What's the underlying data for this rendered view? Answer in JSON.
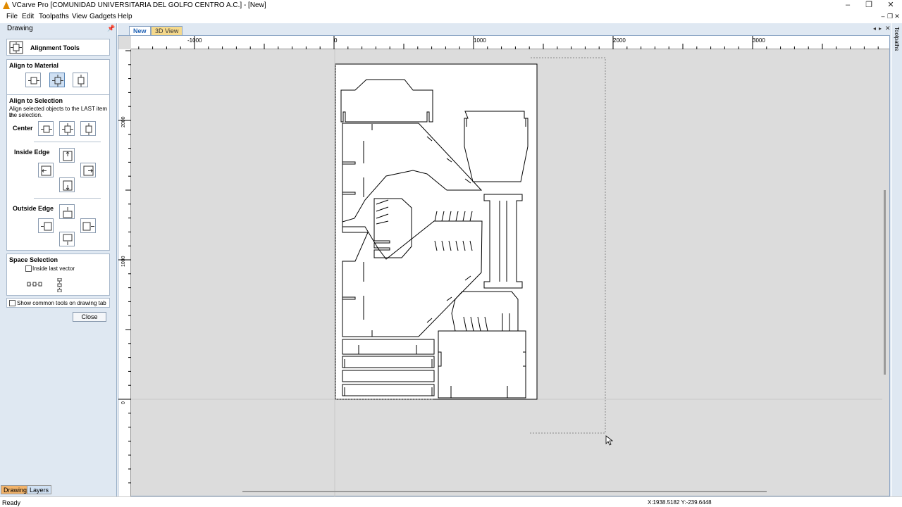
{
  "window": {
    "title": "VCarve Pro [COMUNIDAD UNIVERSITARIA DEL GOLFO CENTRO  A.C.] - [New]",
    "minimize": "–",
    "maximize": "❐",
    "close": "✕"
  },
  "menu": [
    "File",
    "Edit",
    "Toolpaths",
    "View",
    "Gadgets",
    "Help"
  ],
  "sidebar": {
    "header": "Drawing",
    "pin_icon": "pin-icon",
    "tool_title": "Alignment Tools",
    "align_material": {
      "title": "Align to Material"
    },
    "align_selection": {
      "title": "Align to Selection",
      "description_line1": "Align selected objects to the LAST item in",
      "description_line2": "the selection.",
      "center_label": "Center",
      "inside_edge_label": "Inside Edge",
      "outside_edge_label": "Outside Edge"
    },
    "space_selection": {
      "title": "Space Selection",
      "inside_last_vector": "Inside last vector"
    },
    "show_common_tools": "Show common tools on drawing tab",
    "close_label": "Close",
    "bottom_tabs": [
      "Drawing",
      "Layers"
    ]
  },
  "document": {
    "tabs": [
      {
        "label": "New",
        "active": true
      },
      {
        "label": "3D View",
        "active": false
      }
    ],
    "ruler_top_labels": [
      "-1000",
      "0",
      "1000",
      "2000",
      "3000"
    ],
    "ruler_left_labels": [
      "2000",
      "1000",
      "0"
    ]
  },
  "right_rail": {
    "label": "Toolpaths"
  },
  "status": {
    "text": "Ready",
    "coords": "X:1938.5182 Y:-239.6448"
  },
  "colors": {
    "accent_blue": "#1f62b6",
    "tab_active": "#ffffff",
    "tab_3d": "#f5d98c",
    "drawing_tab": "#f2b36a",
    "layers_tab": "#cfe0f3"
  }
}
